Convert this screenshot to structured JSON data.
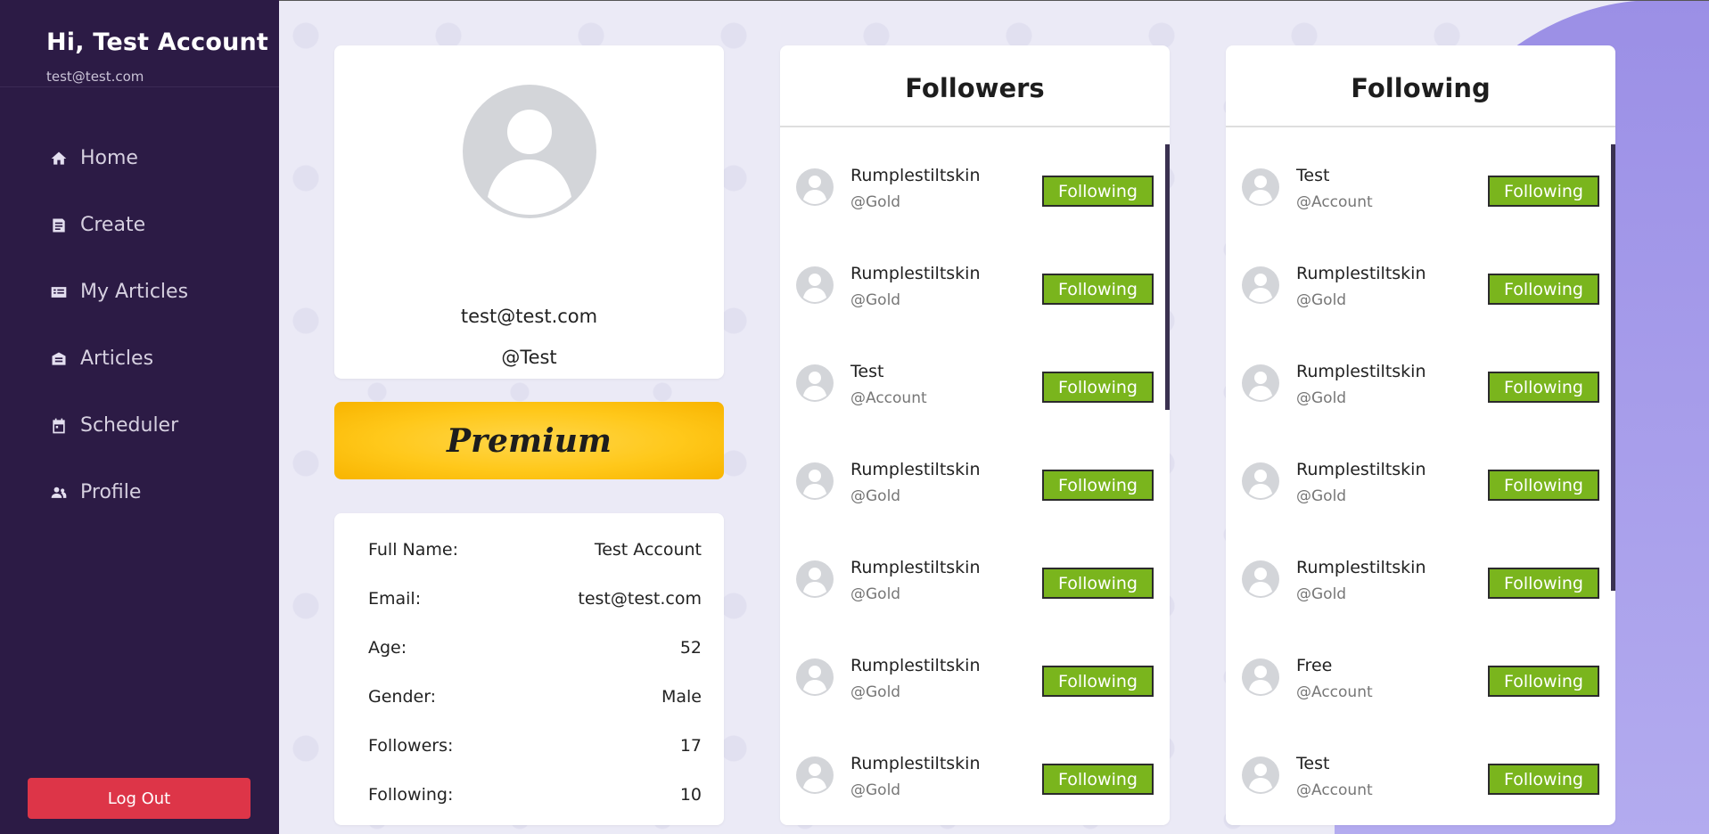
{
  "sidebar": {
    "greeting": "Hi, Test Account",
    "email": "test@test.com",
    "nav": [
      {
        "label": "Home",
        "icon": "home-icon"
      },
      {
        "label": "Create",
        "icon": "create-icon"
      },
      {
        "label": "My Articles",
        "icon": "my-articles-icon"
      },
      {
        "label": "Articles",
        "icon": "articles-icon"
      },
      {
        "label": "Scheduler",
        "icon": "calendar-icon"
      },
      {
        "label": "Profile",
        "icon": "people-icon"
      }
    ],
    "logout_label": "Log Out"
  },
  "profile": {
    "email": "test@test.com",
    "handle": "@Test",
    "badge": "Premium"
  },
  "info": [
    {
      "label": "Full Name:",
      "value": "Test Account"
    },
    {
      "label": "Email:",
      "value": "test@test.com"
    },
    {
      "label": "Age:",
      "value": "52"
    },
    {
      "label": "Gender:",
      "value": "Male"
    },
    {
      "label": "Followers:",
      "value": "17"
    },
    {
      "label": "Following:",
      "value": "10"
    }
  ],
  "followers": {
    "title": "Followers",
    "items": [
      {
        "name": "Rumplestiltskin",
        "handle": "@Gold",
        "button": "Following"
      },
      {
        "name": "Rumplestiltskin",
        "handle": "@Gold",
        "button": "Following"
      },
      {
        "name": "Test",
        "handle": "@Account",
        "button": "Following"
      },
      {
        "name": "Rumplestiltskin",
        "handle": "@Gold",
        "button": "Following"
      },
      {
        "name": "Rumplestiltskin",
        "handle": "@Gold",
        "button": "Following"
      },
      {
        "name": "Rumplestiltskin",
        "handle": "@Gold",
        "button": "Following"
      },
      {
        "name": "Rumplestiltskin",
        "handle": "@Gold",
        "button": "Following"
      }
    ]
  },
  "following": {
    "title": "Following",
    "items": [
      {
        "name": "Test",
        "handle": "@Account",
        "button": "Following"
      },
      {
        "name": "Rumplestiltskin",
        "handle": "@Gold",
        "button": "Following"
      },
      {
        "name": "Rumplestiltskin",
        "handle": "@Gold",
        "button": "Following"
      },
      {
        "name": "Rumplestiltskin",
        "handle": "@Gold",
        "button": "Following"
      },
      {
        "name": "Rumplestiltskin",
        "handle": "@Gold",
        "button": "Following"
      },
      {
        "name": "Free",
        "handle": "@Account",
        "button": "Following"
      },
      {
        "name": "Test",
        "handle": "@Account",
        "button": "Following"
      }
    ]
  },
  "colors": {
    "sidebar": "#2c1b45",
    "logout": "#dd3548",
    "follow_button": "#7ab51d",
    "premium": "#ffc81a",
    "accent_purple": "#9b8fe6"
  }
}
